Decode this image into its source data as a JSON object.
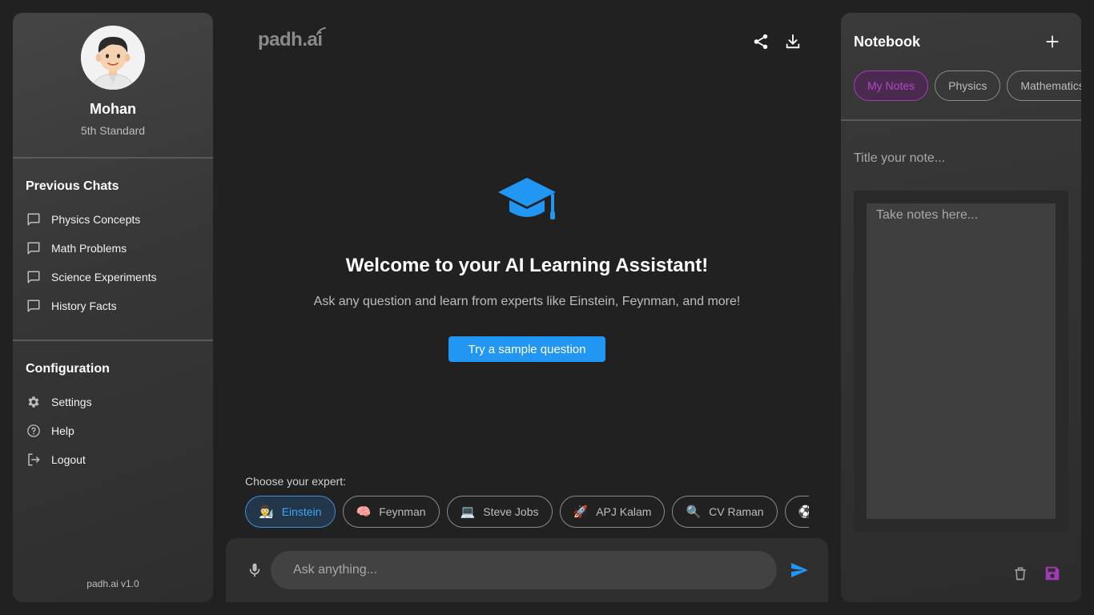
{
  "profile": {
    "name": "Mohan",
    "grade": "5th Standard"
  },
  "previous_chats": {
    "title": "Previous Chats",
    "items": [
      {
        "label": "Physics Concepts",
        "icon": "chat-bubble-icon"
      },
      {
        "label": "Math Problems",
        "icon": "chat-bubble-icon"
      },
      {
        "label": "Science Experiments",
        "icon": "chat-bubble-icon"
      },
      {
        "label": "History Facts",
        "icon": "chat-bubble-icon"
      }
    ]
  },
  "configuration": {
    "title": "Configuration",
    "items": [
      {
        "label": "Settings",
        "icon": "gear-icon"
      },
      {
        "label": "Help",
        "icon": "help-circle-icon"
      },
      {
        "label": "Logout",
        "icon": "logout-icon"
      }
    ]
  },
  "version": "padh.ai v1.0",
  "brand": {
    "logo_text": "padh.ai"
  },
  "hero": {
    "title": "Welcome to your AI Learning Assistant!",
    "subtitle": "Ask any question and learn from experts like Einstein, Feynman, and more!",
    "sample_button": "Try a sample question",
    "icon": "graduation-cap-icon"
  },
  "experts": {
    "label": "Choose your expert:",
    "items": [
      {
        "emoji": "👨‍🔬",
        "name": "Einstein",
        "active": true
      },
      {
        "emoji": "🧠",
        "name": "Feynman"
      },
      {
        "emoji": "💻",
        "name": "Steve Jobs"
      },
      {
        "emoji": "🚀",
        "name": "APJ Kalam"
      },
      {
        "emoji": "🔍",
        "name": "CV Raman"
      },
      {
        "emoji": "⚽",
        "name": ""
      }
    ]
  },
  "input": {
    "placeholder": "Ask anything..."
  },
  "notebook": {
    "title": "Notebook",
    "tabs": [
      {
        "label": "My Notes",
        "active": true
      },
      {
        "label": "Physics"
      },
      {
        "label": "Mathematics"
      }
    ],
    "title_placeholder": "Title your note...",
    "body_placeholder": "Take notes here..."
  },
  "colors": {
    "accent_blue": "#2196f3",
    "accent_purple": "#a23ab5",
    "background": "#212121"
  }
}
